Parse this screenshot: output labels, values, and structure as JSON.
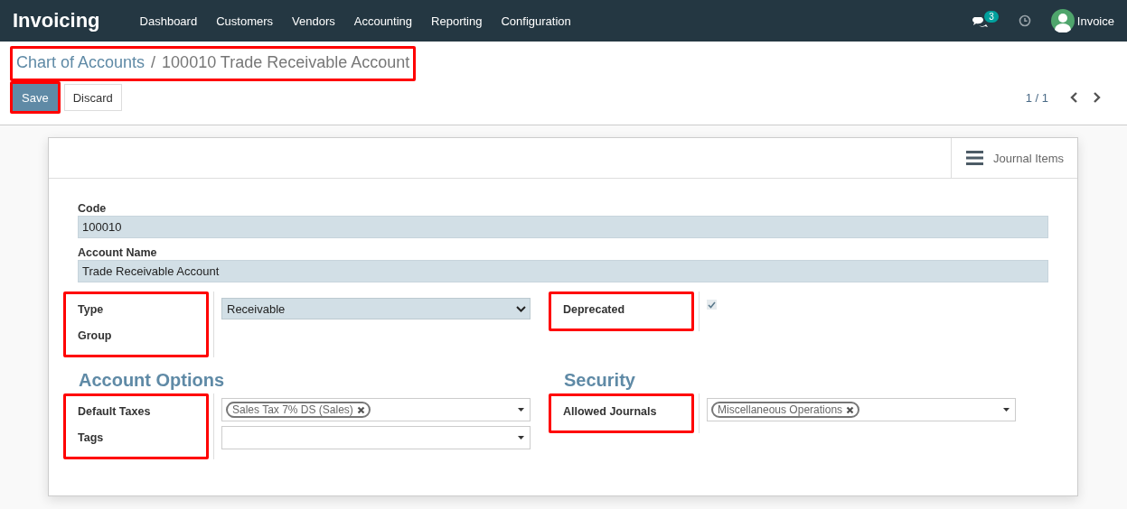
{
  "app": {
    "name": "Invoicing"
  },
  "menu": [
    "Dashboard",
    "Customers",
    "Vendors",
    "Accounting",
    "Reporting",
    "Configuration"
  ],
  "systray": {
    "messages_count": "3",
    "user": "Invoice"
  },
  "breadcrumb": {
    "highlighted": true,
    "separator": "/",
    "items": [
      {
        "label": "Chart of Accounts",
        "kind": "link"
      },
      {
        "label": "100010 Trade Receivable Account",
        "kind": "current"
      }
    ]
  },
  "buttons": [
    {
      "label": "Save",
      "kind": "primary",
      "highlighted": true
    },
    {
      "label": "Discard",
      "kind": "secondary"
    }
  ],
  "pager": {
    "value": "1 / 1"
  },
  "sheet": {
    "smart_buttons": [
      {
        "label": "Journal Items"
      }
    ],
    "fields": [
      {
        "label": "Code",
        "value": "100010"
      },
      {
        "label": "Account Name",
        "value": "Trade Receivable Account"
      }
    ],
    "groups": [
      {
        "highlighted": true,
        "fields": [
          {
            "label": "Type",
            "kind": "select",
            "value": "Receivable"
          },
          {
            "label": "Group",
            "kind": "empty"
          }
        ]
      },
      {
        "highlighted": true,
        "fields": [
          {
            "label": "Deprecated",
            "kind": "checkbox",
            "checked": true
          }
        ]
      },
      {
        "title": "Account Options",
        "highlighted": true,
        "fields": [
          {
            "label": "Default Taxes",
            "kind": "tags",
            "tags": [
              "Sales Tax 7% DS (Sales)"
            ]
          },
          {
            "label": "Tags",
            "kind": "tags"
          }
        ]
      },
      {
        "title": "Security",
        "highlighted": true,
        "fields": [
          {
            "label": "Allowed Journals",
            "kind": "tags",
            "tags": [
              "Miscellaneous Operations"
            ]
          }
        ]
      }
    ]
  }
}
